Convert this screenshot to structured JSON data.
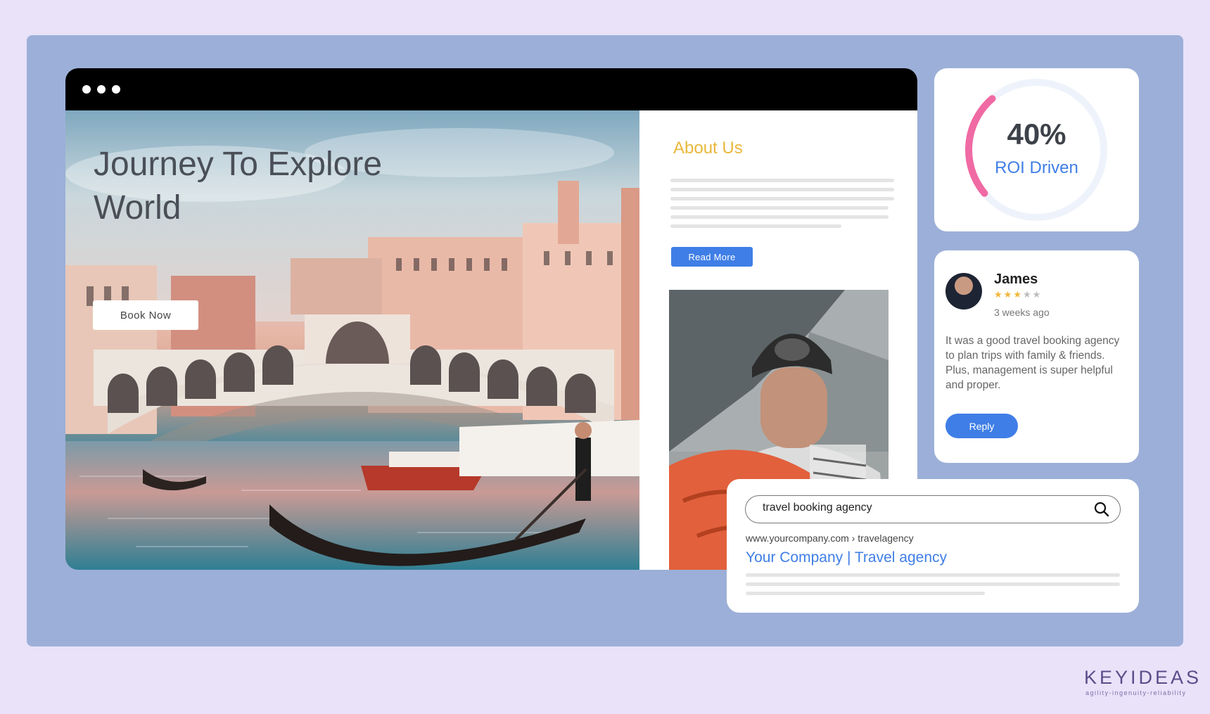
{
  "hero": {
    "title": "Journey To Explore World",
    "book_label": "Book Now"
  },
  "about": {
    "title": "About Us",
    "read_more_label": "Read More"
  },
  "roi": {
    "value": "40%",
    "label": "ROI Driven",
    "progress_fraction": 0.4,
    "accent_color": "#f06aa4"
  },
  "review": {
    "name": "James",
    "rating": 3,
    "rating_max": 5,
    "time": "3 weeks ago",
    "text": "It was a good travel booking agency to plan trips with family & friends. Plus, management is super helpful and proper.",
    "reply_label": "Reply"
  },
  "search": {
    "query": "travel booking agency",
    "result_url": "www.yourcompany.com › travelagency",
    "result_title": "Your Company | Travel agency"
  },
  "brand": {
    "logo": "KEYIDEAS",
    "tagline": "agility-ingenuity-reliability"
  },
  "colors": {
    "accent": "#3f7ee6",
    "heading_gold": "#e9b73a",
    "background": "#e9e2f9",
    "panel": "#9cafd8"
  }
}
